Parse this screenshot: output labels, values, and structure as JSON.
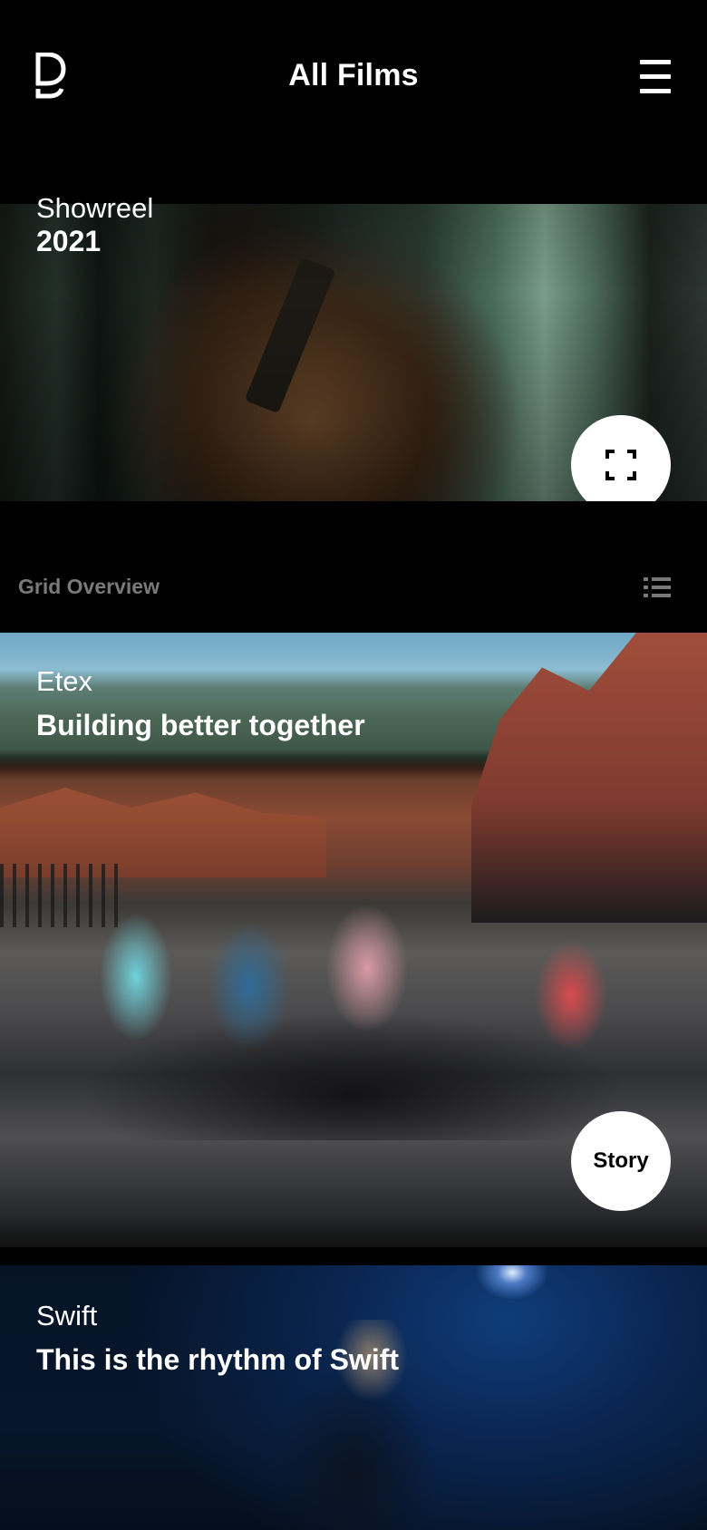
{
  "header": {
    "title": "All Films",
    "logo_icon": "d-logo-icon",
    "menu_icon": "hamburger-menu-icon"
  },
  "showreel": {
    "label": "Showreel",
    "year": "2021",
    "fullscreen_icon": "fullscreen-icon"
  },
  "grid": {
    "label": "Grid Overview",
    "view_icon": "list-view-icon"
  },
  "films": [
    {
      "client": "Etex",
      "title": "Building better together",
      "button_label": "Story"
    },
    {
      "client": "Swift",
      "title": "This is the rhythm of Swift"
    }
  ],
  "colors": {
    "background": "#000000",
    "text": "#ffffff",
    "muted": "#7a7a7a",
    "button_bg": "#ffffff"
  }
}
